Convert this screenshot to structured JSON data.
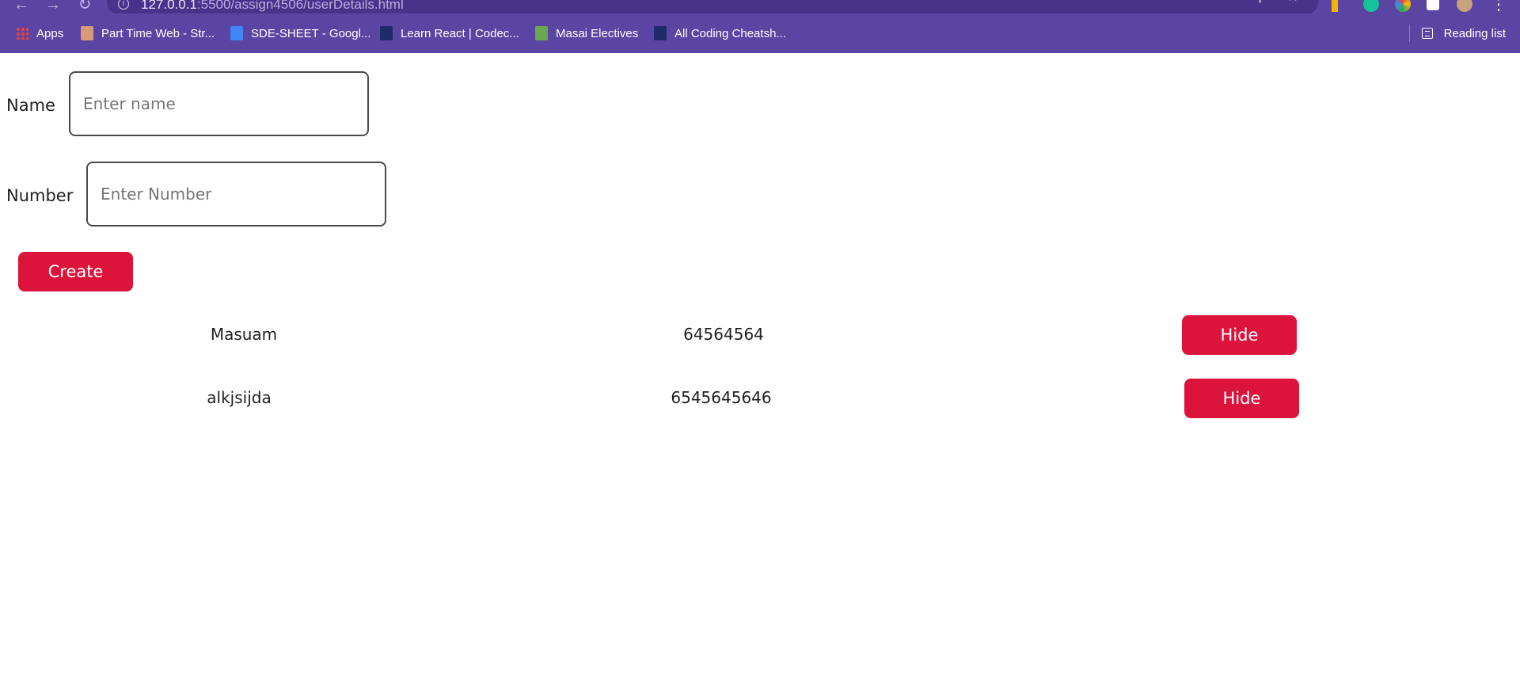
{
  "browser": {
    "url_host": "127.0.0.1",
    "url_rest": ":5500/assign4506/userDetails.html",
    "bookmarks": [
      {
        "label": "Apps",
        "icon": "apps-grid-icon",
        "color": "#ea4335"
      },
      {
        "label": "Part Time Web - Str...",
        "icon": "bookmark-page-icon",
        "color": "#d99a79"
      },
      {
        "label": "SDE-SHEET - Googl...",
        "icon": "google-docs-icon",
        "color": "#4285f4"
      },
      {
        "label": "Learn React | Codec...",
        "icon": "codecademy-icon",
        "color": "#1f2a6b"
      },
      {
        "label": "Masai Electives",
        "icon": "book-icon",
        "color": "#6aa84f"
      },
      {
        "label": "All Coding Cheatsh...",
        "icon": "codecademy-icon",
        "color": "#1f2a6b"
      }
    ],
    "reading_list": "Reading list"
  },
  "form": {
    "name_label": "Name",
    "name_placeholder": "Enter name",
    "number_label": "Number",
    "number_placeholder": "Enter Number",
    "create_label": "Create"
  },
  "users": [
    {
      "name": "Masuam",
      "number": "64564564",
      "action": "Hide"
    },
    {
      "name": "alkjsijda",
      "number": "6545645646",
      "action": "Hide"
    }
  ],
  "colors": {
    "accent": "#dc143c",
    "browser_bar": "#5b45a3"
  }
}
